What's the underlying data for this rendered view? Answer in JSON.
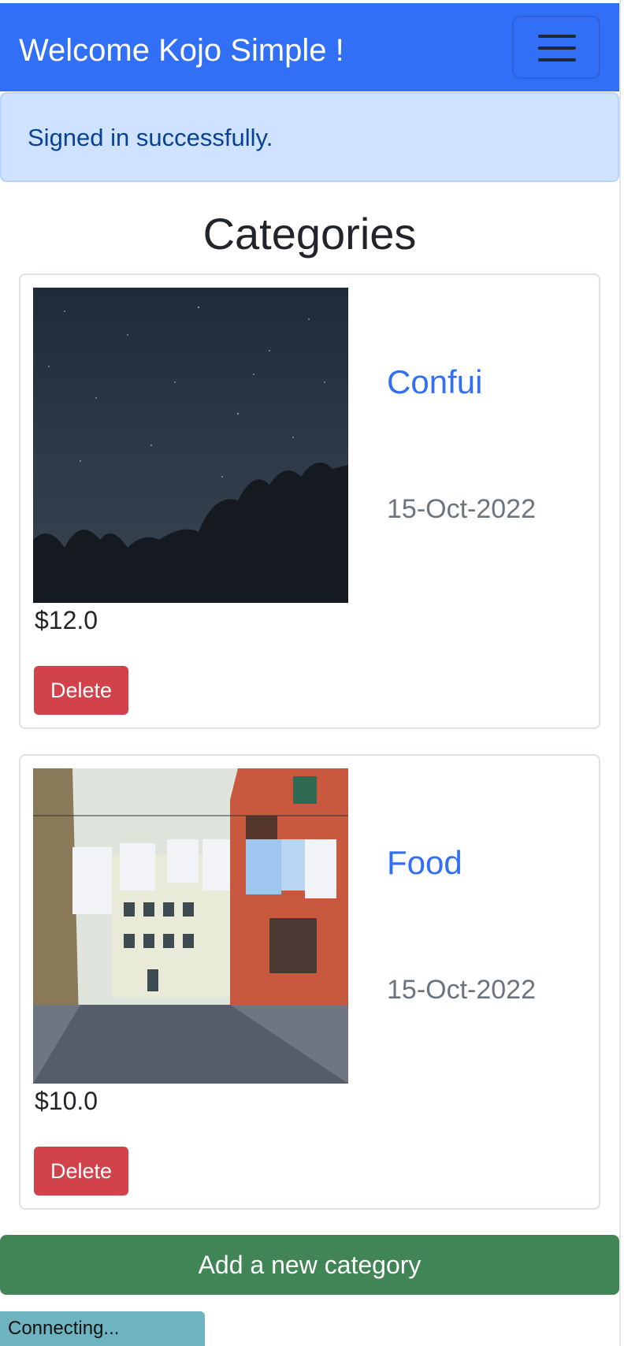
{
  "navbar": {
    "brand": "Welcome Kojo Simple !",
    "menu_icon": "hamburger-menu-icon",
    "color": "#316ff6"
  },
  "alert": {
    "message": "Signed in successfully."
  },
  "page": {
    "title": "Categories"
  },
  "categories": [
    {
      "name": "Confui",
      "date": "15-Oct-2022",
      "price": "$12.0",
      "delete_label": "Delete",
      "image": "night-sky-trees-photo"
    },
    {
      "name": "Food",
      "date": "15-Oct-2022",
      "price": "$10.0",
      "delete_label": "Delete",
      "image": "street-laundry-photo"
    }
  ],
  "actions": {
    "add_label": "Add a new category"
  },
  "status": {
    "text": "Connecting..."
  },
  "colors": {
    "primary": "#316ff6",
    "danger": "#d1424b",
    "success": "#418556",
    "alert_bg": "#cfe2ff"
  }
}
